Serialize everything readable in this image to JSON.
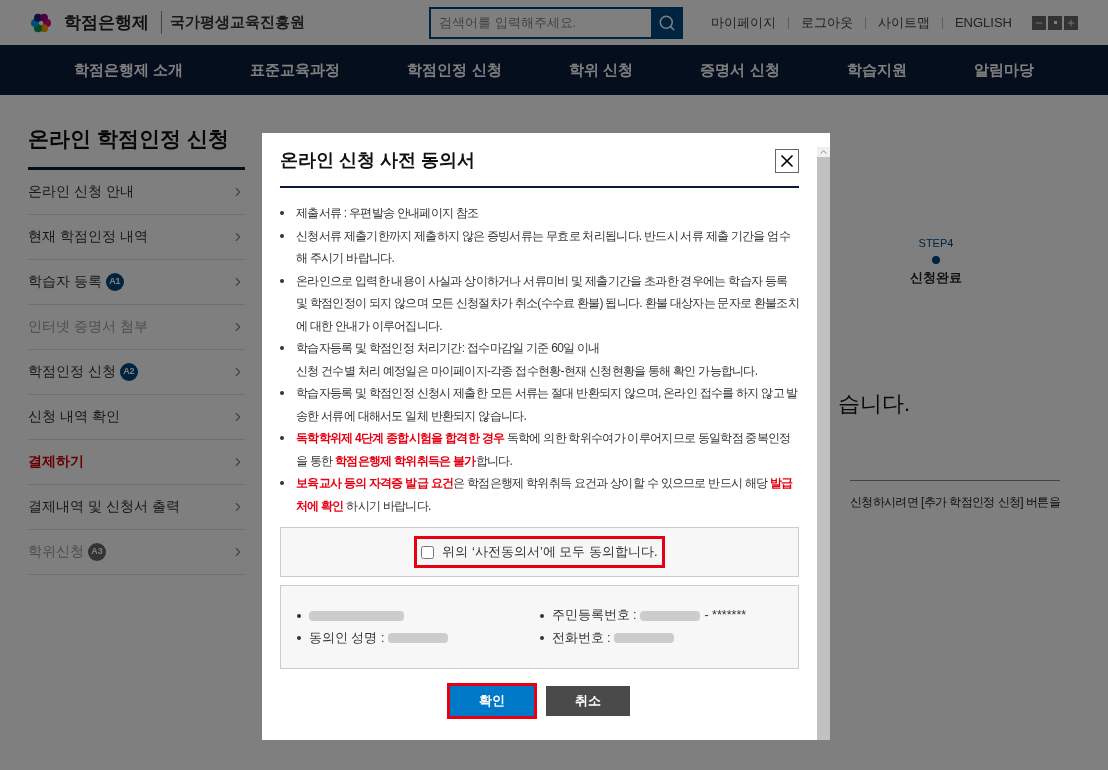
{
  "header": {
    "logo": "학점은행제",
    "org": "국가평생교육진흥원",
    "search": {
      "placeholder": "검색어를 입력해주세요."
    },
    "links": [
      "마이페이지",
      "로그아웃",
      "사이트맵",
      "ENGLISH"
    ]
  },
  "nav": [
    "학점은행제 소개",
    "표준교육과정",
    "학점인정 신청",
    "학위 신청",
    "증명서 신청",
    "학습지원",
    "알림마당"
  ],
  "sidebar": {
    "title": "온라인 학점인정 신청",
    "items": [
      {
        "label": "온라인 신청 안내",
        "selected": false,
        "disabled": false
      },
      {
        "label": "현재 학점인정 내역",
        "selected": false,
        "disabled": false
      },
      {
        "label": "학습자 등록",
        "badge": "A1",
        "selected": false,
        "disabled": false
      },
      {
        "label": "인터넷 증명서 첨부",
        "selected": false,
        "disabled": true
      },
      {
        "label": "학점인정 신청",
        "badge": "A2",
        "selected": false,
        "disabled": false
      },
      {
        "label": "신청 내역 확인",
        "selected": false,
        "disabled": false
      },
      {
        "label": "결제하기",
        "selected": true,
        "disabled": false
      },
      {
        "label": "결제내역 및 신청서 출력",
        "selected": false,
        "disabled": false
      },
      {
        "label": "학위신청",
        "badge": "A3",
        "selected": false,
        "disabled": true
      }
    ]
  },
  "content": {
    "step": {
      "label": "STEP4",
      "name": "신청완료"
    },
    "message": "습니다.",
    "note": "신청하시려면 [추가 학점인정 신청] 버튼을"
  },
  "modal": {
    "title": "온라인 신청 사전 동의서",
    "items": [
      {
        "kind": "bullet",
        "text": "제출서류 : 우편발송 안내페이지 참조"
      },
      {
        "kind": "bullet",
        "text": "신청서류 제출기한까지 제출하지 않은 증빙서류는 무효로 처리됩니다. 반드시 서류 제출 기간을 엄수해 주시기 바랍니다."
      },
      {
        "kind": "bullet",
        "text": "온라인으로 입력한 내용이 사실과 상이하거나 서류미비 및 제출기간을 초과한 경우에는 학습자 등록 및 학점인정이 되지 않으며 모든 신청절차가 취소(수수료 환불) 됩니다. 환불 대상자는 문자로 환불조치에 대한 안내가 이루어집니다."
      },
      {
        "kind": "bullet",
        "text": "학습자등록 및 학점인정 처리기간: 접수마감일 기준 60일 이내"
      },
      {
        "kind": "continuation",
        "text": "신청 건수별 처리 예정일은 마이페이지-각종 접수현황-현재 신청현황을 통해 확인 가능합니다."
      },
      {
        "kind": "bullet",
        "text": "학습자등록 및 학점인정 신청시 제출한 모든 서류는 절대 반환되지 않으며, 온라인 접수를 하지 않고 발송한 서류에 대해서도 일체 반환되지 않습니다."
      },
      {
        "kind": "bullet",
        "text": "**독학학위제 4단계 종합시험을 합격한 경우** 독학에 의한 학위수여가 이루어지므로 동일학점 중복인정을 통한 **학점은행제 학위취득은 불가**합니다."
      },
      {
        "kind": "bullet",
        "text": "**보육교사 등의 자격증 발급 요건**은 학점은행제 학위취득 요건과 상이할 수 있으므로 반드시 해당 **발급처에 확인** 하시기 바랍니다."
      }
    ],
    "agree": {
      "label": "위의 ‘사전동의서’에 모두 동의합니다.",
      "checked": false,
      "highlighted": true
    },
    "info": [
      {
        "redacted": true
      },
      {
        "label": "주민등록번호 :",
        "redacted": true,
        "suffix": "- *******"
      },
      {
        "label": "동의인 성명 :",
        "redacted": true
      },
      {
        "label": "전화번호 :",
        "redacted": true
      }
    ],
    "buttons": [
      {
        "label": "확인",
        "kind": "primary",
        "highlighted": true
      },
      {
        "label": "취소",
        "kind": "secondary",
        "highlighted": false
      }
    ]
  }
}
